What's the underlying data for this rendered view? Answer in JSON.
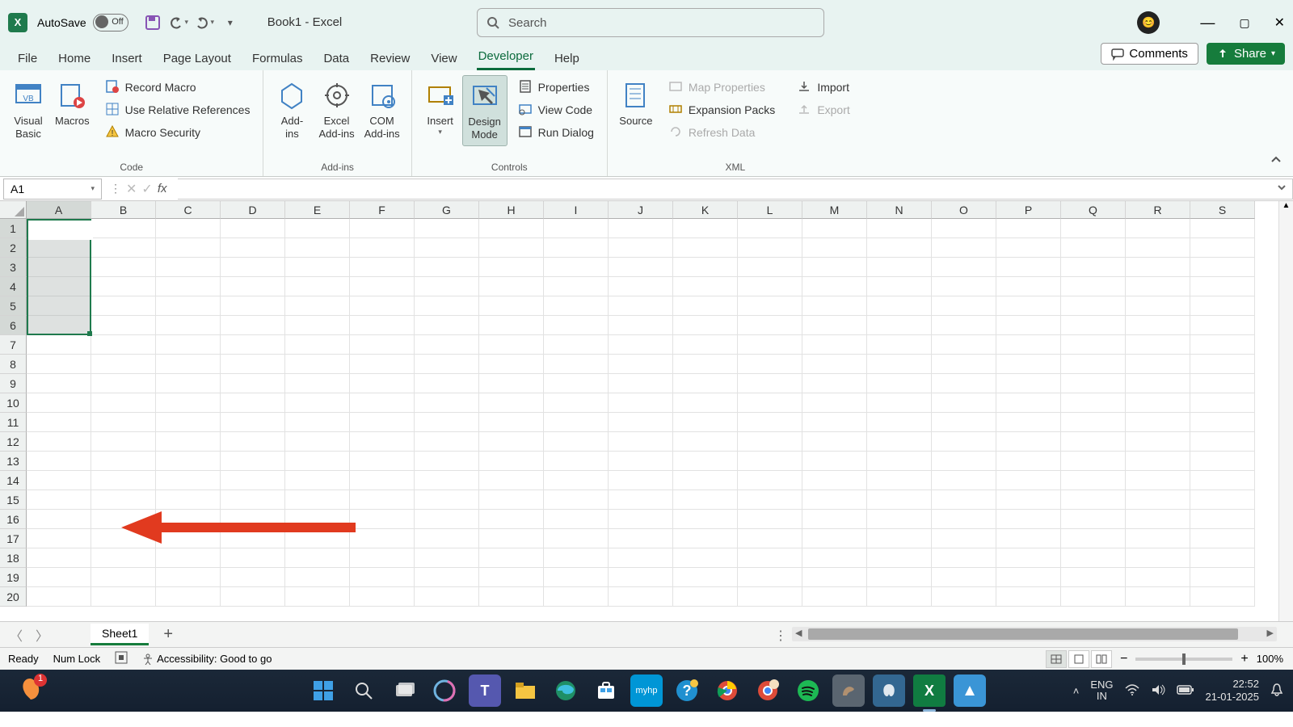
{
  "titlebar": {
    "app_letter": "X",
    "autosave_label": "AutoSave",
    "autosave_state": "Off",
    "doc_title": "Book1  -  Excel",
    "search_placeholder": "Search"
  },
  "window_controls": {
    "min": "—",
    "max": "▢",
    "close": "✕"
  },
  "tabs": {
    "items": [
      "File",
      "Home",
      "Insert",
      "Page Layout",
      "Formulas",
      "Data",
      "Review",
      "View",
      "Developer",
      "Help"
    ],
    "active_index": 8,
    "comments": "Comments",
    "share": "Share"
  },
  "ribbon": {
    "code": {
      "visual_basic": "Visual\nBasic",
      "macros": "Macros",
      "record_macro": "Record Macro",
      "use_relative": "Use Relative References",
      "macro_security": "Macro Security",
      "label": "Code"
    },
    "addins": {
      "addins": "Add-\nins",
      "excel_addins": "Excel\nAdd-ins",
      "com_addins": "COM\nAdd-ins",
      "label": "Add-ins"
    },
    "controls": {
      "insert": "Insert",
      "design_mode": "Design\nMode",
      "properties": "Properties",
      "view_code": "View Code",
      "run_dialog": "Run Dialog",
      "label": "Controls"
    },
    "xml": {
      "source": "Source",
      "map_properties": "Map Properties",
      "expansion_packs": "Expansion Packs",
      "refresh_data": "Refresh Data",
      "import": "Import",
      "export": "Export",
      "label": "XML"
    }
  },
  "formulabar": {
    "namebox": "A1",
    "fx": "fx"
  },
  "grid": {
    "columns": [
      "A",
      "B",
      "C",
      "D",
      "E",
      "F",
      "G",
      "H",
      "I",
      "J",
      "K",
      "L",
      "M",
      "N",
      "O",
      "P",
      "Q",
      "R",
      "S"
    ],
    "rows": [
      "1",
      "2",
      "3",
      "4",
      "5",
      "6",
      "7",
      "8",
      "9",
      "10",
      "11",
      "12",
      "13",
      "14",
      "15",
      "16",
      "17",
      "18",
      "19",
      "20"
    ],
    "selected_range": "A1:A6"
  },
  "sheetbar": {
    "sheet1": "Sheet1",
    "add": "+"
  },
  "statusbar": {
    "ready": "Ready",
    "numlock": "Num Lock",
    "accessibility": "Accessibility: Good to go",
    "zoom": "100%"
  },
  "taskbar": {
    "lang1": "ENG",
    "lang2": "IN",
    "time": "22:52",
    "date": "21-01-2025"
  }
}
